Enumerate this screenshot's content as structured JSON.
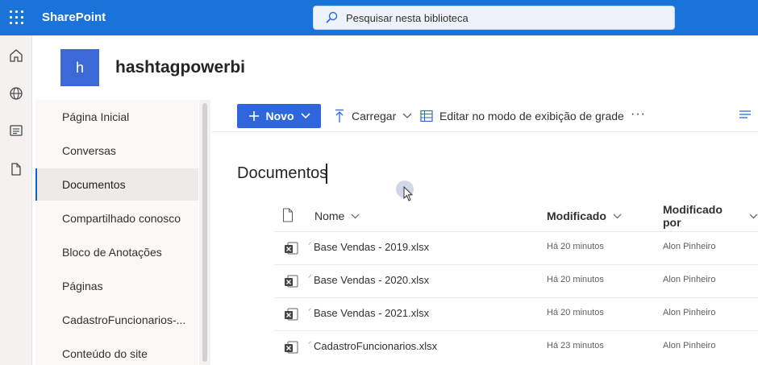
{
  "suite": {
    "brand": "SharePoint",
    "search_placeholder": "Pesquisar nesta biblioteca"
  },
  "site": {
    "logo_letter": "h",
    "title": "hashtagpowerbi"
  },
  "appbar": {
    "icons": [
      "home-icon",
      "globe-icon",
      "news-icon",
      "file-icon"
    ]
  },
  "nav": {
    "items": [
      {
        "label": "Página Inicial"
      },
      {
        "label": "Conversas"
      },
      {
        "label": "Documentos"
      },
      {
        "label": "Compartilhado conosco"
      },
      {
        "label": "Bloco de Anotações"
      },
      {
        "label": "Páginas"
      },
      {
        "label": "CadastroFuncionarios-..."
      },
      {
        "label": "Conteúdo do site"
      }
    ],
    "selected": "Documentos"
  },
  "command_bar": {
    "new_label": "Novo",
    "upload_label": "Carregar",
    "grid_edit_label": "Editar no modo de exibição de grade",
    "more_label": "···"
  },
  "library": {
    "title": "Documentos"
  },
  "columns": {
    "name": "Nome",
    "modified": "Modificado",
    "modified_by": "Modificado por"
  },
  "files": [
    {
      "name": "Base Vendas - 2019.xlsx",
      "modified": "Há 20 minutos",
      "modified_by": "Alon Pinheiro"
    },
    {
      "name": "Base Vendas - 2020.xlsx",
      "modified": "Há 20 minutos",
      "modified_by": "Alon Pinheiro"
    },
    {
      "name": "Base Vendas - 2021.xlsx",
      "modified": "Há 20 minutos",
      "modified_by": "Alon Pinheiro"
    },
    {
      "name": "CadastroFuncionarios.xlsx",
      "modified": "Há 23 minutos",
      "modified_by": "Alon Pinheiro"
    }
  ],
  "colors": {
    "suite_bar": "#1a73d9",
    "accent": "#2f66dc",
    "site_logo": "#3d68d8"
  }
}
